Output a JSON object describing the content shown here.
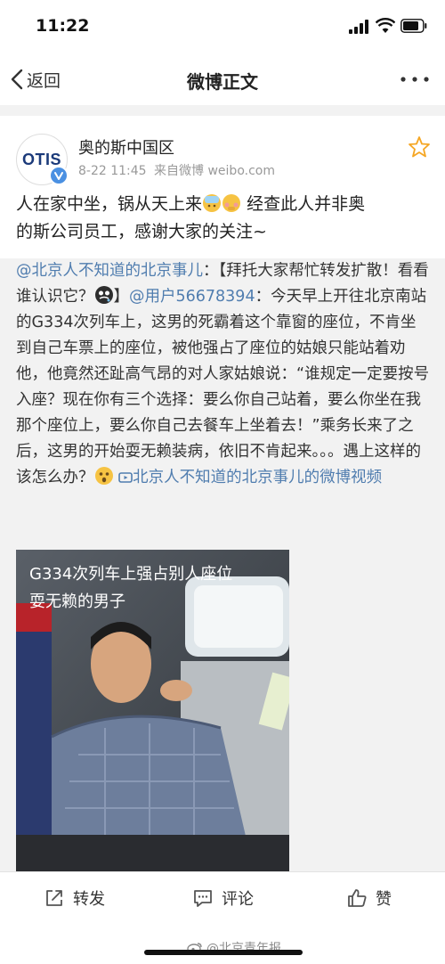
{
  "status_bar": {
    "time": "11:22"
  },
  "nav": {
    "back_label": "返回",
    "title": "微博正文"
  },
  "post": {
    "author": "奥的斯中国区",
    "avatar_logo_text": "OTIS",
    "date": "8-22 11:45",
    "source": "来自微博 weibo.com",
    "text_line1": "人在家中坐，锅从天上来",
    "text_line1_after": "经查此人并非奥",
    "text_line2": "的斯公司员工，感谢大家的关注~"
  },
  "repost": {
    "mention_account": "@北京人不知道的北京事儿",
    "part1": "：【拜托大家帮忙转发扩散！看看谁认识它？",
    "part2": "】",
    "mention_user": "@用户56678394",
    "body": "：今天早上开往北京南站的G334次列车上，这男的死霸着这个靠窗的座位，不肯坐到自己车票上的座位，被他强占了座位的姑娘只能站着劝他，他竟然还趾高气昂的对人家姑娘说：“谁规定一定要按号入座？现在你有三个选择：要么你自己站着，要么你坐在我那个座位上，要么你自己去餐车上坐着去！”乘务长来了之后，这男的开始耍无赖装病，依旧不肯起来。。。遇上这样的该怎么办？",
    "video_link": "北京人不知道的北京事儿的微博视频",
    "video_caption_line1": "G334次列车上强占别人座位",
    "video_caption_line2": "耍无赖的男子"
  },
  "actions": {
    "repost": "转发",
    "comment": "评论",
    "like": "赞"
  },
  "watermark": "@北京青年报",
  "colors": {
    "link": "#507daf",
    "background_gray": "#f2f2f2",
    "star": "#f5a623",
    "verified": "#4a90e2"
  }
}
